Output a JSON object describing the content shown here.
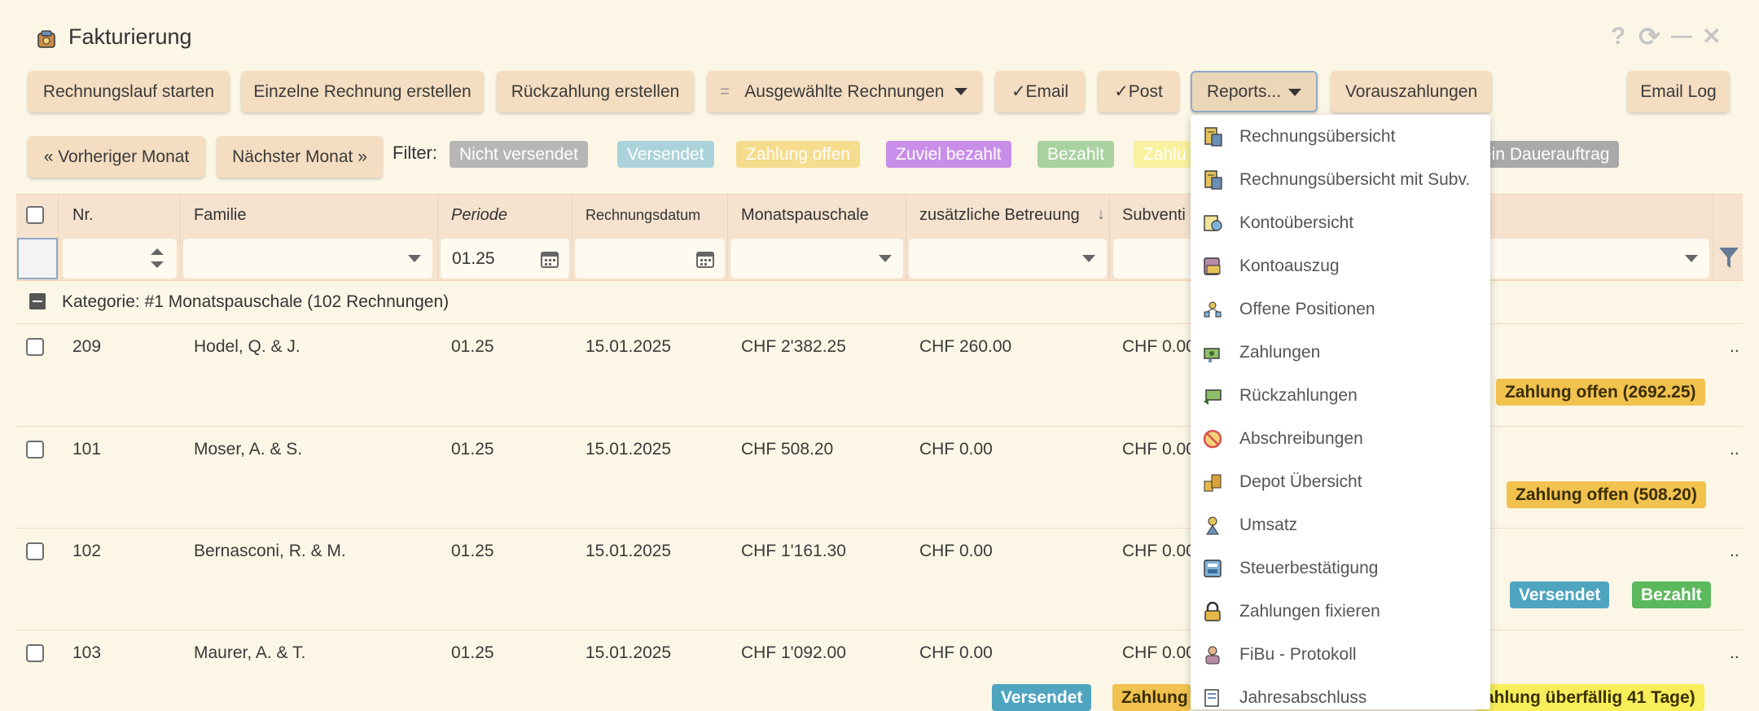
{
  "window": {
    "title": "Fakturierung",
    "controls": [
      "?",
      "⟳",
      "—",
      "✕"
    ]
  },
  "toolbar": {
    "start_run": "Rechnungslauf starten",
    "single_invoice": "Einzelne Rechnung erstellen",
    "refund": "Rückzahlung erstellen",
    "selected_prefix": "=",
    "selected": "Ausgewählte Rechnungen",
    "email": "✓Email",
    "post": "✓Post",
    "reports": "Reports...",
    "prepayments": "Vorauszahlungen",
    "email_log": "Email Log"
  },
  "nav": {
    "prev_month": "« Vorheriger Monat",
    "next_month": "Nächster Monat »",
    "filter_label": "Filter:"
  },
  "filters": [
    {
      "label": "Nicht versendet",
      "bg": "#b6b6b6",
      "fg": "#ffffff"
    },
    {
      "label": "Versendet",
      "bg": "#acd3db",
      "fg": "#ffffff"
    },
    {
      "label": "Zahlung offen",
      "bg": "#f6dc8d",
      "fg": "#ffffff"
    },
    {
      "label": "Zuviel bezahlt",
      "bg": "#c98ee8",
      "fg": "#ffffff"
    },
    {
      "label": "Bezahlt",
      "bg": "#a9d2a0",
      "fg": "#ffffff"
    },
    {
      "label": "Zahlu",
      "bg": "#f9f0a0",
      "fg": "#ffffff"
    },
    {
      "label": "ein Dauerauftrag",
      "bg": "#a9a9a9",
      "fg": "#ffffff"
    }
  ],
  "table": {
    "headers": {
      "nr": "Nr.",
      "familie": "Familie",
      "periode": "Periode",
      "rechnungsdatum": "Rechnungsdatum",
      "monatspauschale": "Monatspauschale",
      "zusaetzlich": "zusätzliche Betreuung",
      "subvention": "Subventi"
    },
    "filter_periode": "01.25",
    "group": "Kategorie: #1 Monatspauschale (102 Rechnungen)",
    "rows": [
      {
        "nr": "209",
        "familie": "Hodel, Q. & J.",
        "periode": "01.25",
        "datum": "15.01.2025",
        "pauschale": "CHF 2'382.25",
        "zusatz": "CHF 260.00",
        "subv": "CHF 0.00",
        "more": ".."
      },
      {
        "nr": "101",
        "familie": "Moser, A. & S.",
        "periode": "01.25",
        "datum": "15.01.2025",
        "pauschale": "CHF 508.20",
        "zusatz": "CHF 0.00",
        "subv": "CHF 0.00",
        "more": ".."
      },
      {
        "nr": "102",
        "familie": "Bernasconi, R. & M.",
        "periode": "01.25",
        "datum": "15.01.2025",
        "pauschale": "CHF 1'161.30",
        "zusatz": "CHF 0.00",
        "subv": "CHF 0.00",
        "more": ".."
      },
      {
        "nr": "103",
        "familie": "Maurer, A. & T.",
        "periode": "01.25",
        "datum": "15.01.2025",
        "pauschale": "CHF 1'092.00",
        "zusatz": "CHF 0.00",
        "subv": "CHF 0.00",
        "more": ".."
      }
    ],
    "status": {
      "r1": "Zahlung offen (2692.25)",
      "r2": "Zahlung offen (508.20)",
      "r3a": "Versendet",
      "r3b": "Bezahlt",
      "r4a": "Versendet",
      "r4b": "Zahlung",
      "r4c": "ahlung überfällig 41 Tage)"
    }
  },
  "reports_menu": [
    {
      "label": "Rechnungsübersicht",
      "icon": "invoice-icon"
    },
    {
      "label": "Rechnungsübersicht mit Subv.",
      "icon": "invoice-subsidy-icon"
    },
    {
      "label": "Kontoübersicht",
      "icon": "account-overview-icon"
    },
    {
      "label": "Kontoauszug",
      "icon": "account-statement-icon"
    },
    {
      "label": "Offene Positionen",
      "icon": "open-items-icon"
    },
    {
      "label": "Zahlungen",
      "icon": "payments-icon"
    },
    {
      "label": "Rückzahlungen",
      "icon": "refunds-icon"
    },
    {
      "label": "Abschreibungen",
      "icon": "write-off-icon"
    },
    {
      "label": "Depot Übersicht",
      "icon": "deposit-icon"
    },
    {
      "label": "Umsatz",
      "icon": "revenue-icon"
    },
    {
      "label": "Steuerbestätigung",
      "icon": "tax-certificate-icon"
    },
    {
      "label": "Zahlungen fixieren",
      "icon": "lock-icon"
    },
    {
      "label": "FiBu - Protokoll",
      "icon": "accounting-log-icon"
    },
    {
      "label": "Jahresabschluss",
      "icon": "year-end-icon"
    }
  ]
}
